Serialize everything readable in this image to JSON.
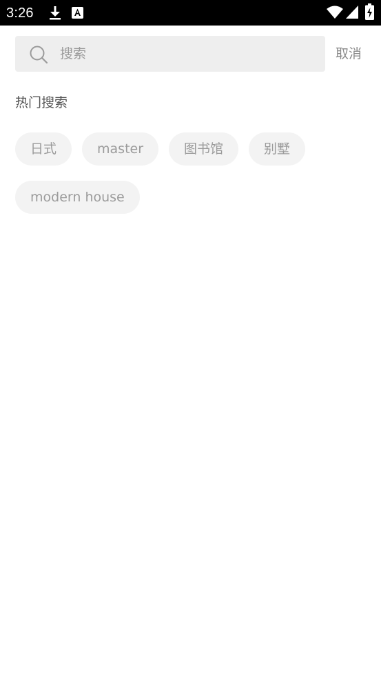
{
  "status_bar": {
    "time": "3:26",
    "icons": [
      "download-icon",
      "app-notification-icon",
      "wifi-icon",
      "cell-signal-icon",
      "battery-charging-icon"
    ]
  },
  "search": {
    "placeholder": "搜索",
    "value": "",
    "cancel_label": "取消"
  },
  "hot_search": {
    "title": "热门搜索",
    "tags": [
      "日式",
      "master",
      "图书馆",
      "别墅",
      "modern house"
    ]
  },
  "colors": {
    "status_bar_bg": "#000000",
    "search_bg": "#eeeeee",
    "tag_bg": "#f3f3f3",
    "tag_text": "#9b9b9b"
  }
}
